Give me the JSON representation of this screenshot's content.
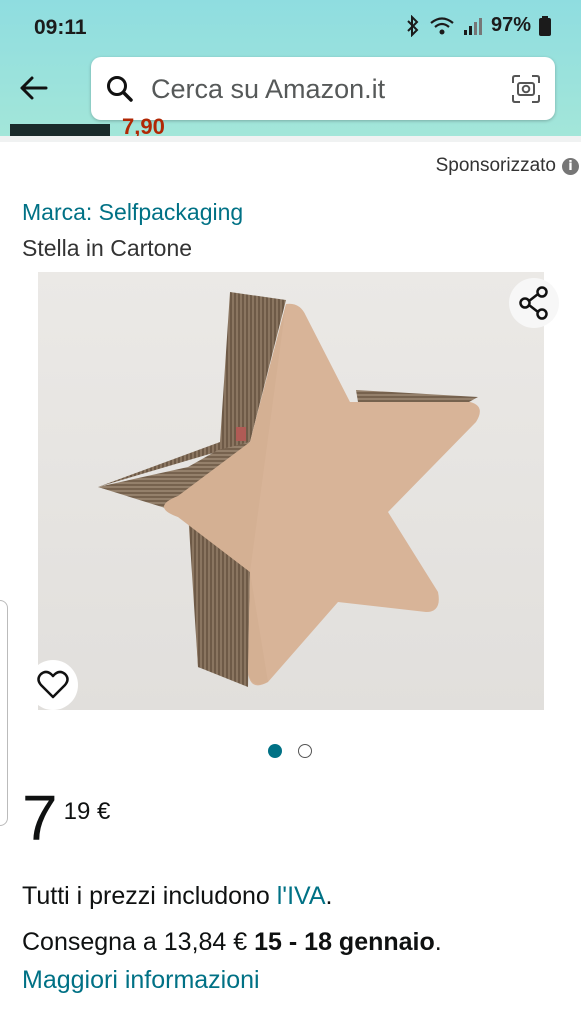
{
  "status_bar": {
    "time": "09:11",
    "battery": "97%"
  },
  "search": {
    "placeholder": "Cerca su Amazon.it"
  },
  "peek_banner": {
    "price_text": "7,90"
  },
  "sponsored": {
    "label": "Sponsorizzato",
    "info_icon": "i"
  },
  "product": {
    "brand": "Marca: Selfpackaging",
    "title": "Stella in Cartone",
    "image_desc_icon": "star-product-image",
    "carousel": {
      "total": 2,
      "active": 1
    }
  },
  "price": {
    "whole": "7",
    "fraction": "19 €"
  },
  "tax": {
    "prefix": "Tutti i prezzi includono ",
    "link": "l'IVA",
    "suffix": "."
  },
  "delivery": {
    "prefix": "Consegna a 13,84 € ",
    "dates": "15 - 18 gennaio",
    "suffix": "."
  },
  "more_info": "Maggiori informazioni",
  "colors": {
    "accent": "#007185",
    "header": "#8fdde0",
    "price_red": "#b12704"
  }
}
